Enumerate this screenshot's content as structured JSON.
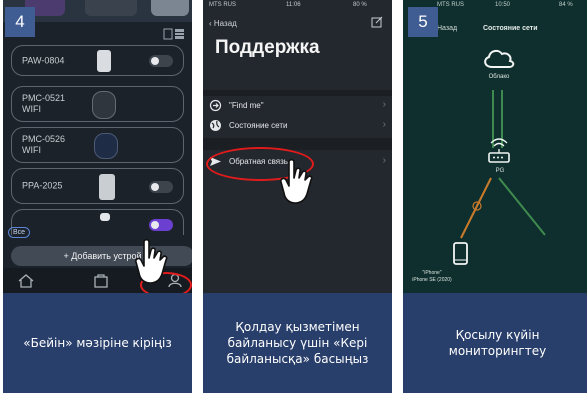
{
  "panels": [
    {
      "step": "4",
      "devices": [
        {
          "name": "PAW-0804",
          "has_toggle": true
        },
        {
          "name": "PMC-0521\nWIFI",
          "has_toggle": false
        },
        {
          "name": "PMC-0526\nWIFI",
          "has_toggle": false
        },
        {
          "name": "PPA-2025",
          "has_toggle": true
        }
      ],
      "filter_chip": "Все",
      "add_button": "+ Добавить устрой",
      "caption": "«Бейін» мәзіріне кіріңіз"
    },
    {
      "status": {
        "carrier": "MTS RUS",
        "time": "11:06",
        "battery": "80 %"
      },
      "back": "Назад",
      "title": "Поддержка",
      "rows": [
        {
          "icon": "arrow-circle-icon",
          "label": "\"Find me\""
        },
        {
          "icon": "globe-icon",
          "label": "Состояние сети"
        },
        {
          "icon": "send-icon",
          "label": "Обратная связь"
        }
      ],
      "caption": "Қолдау қызметімен байланысу үшін «Кері байланысқа» басыңыз"
    },
    {
      "step": "5",
      "status": {
        "carrier": "MTS RUS",
        "time": "10:50",
        "battery": "84 %"
      },
      "back": "Назад",
      "title": "Состояние сети",
      "cloud_label": "Облако",
      "router_label": "PG",
      "phone_label": "\"iPhone\"\niPhone SE (2020)",
      "caption": "Қосылу күйін мониторингтеу"
    }
  ],
  "colors": {
    "caption_bg": "#283e6b",
    "step_badge": "#3f5c93",
    "highlight": "#e01b1b",
    "link_green": "#3f8a4f",
    "link_orange": "#c87a2c"
  }
}
